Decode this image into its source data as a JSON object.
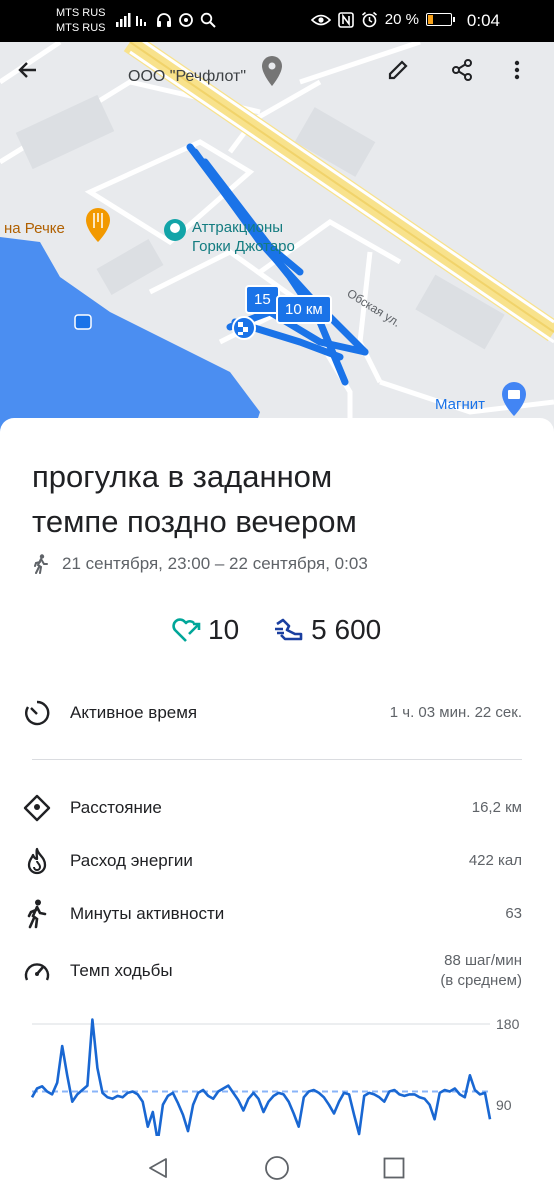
{
  "status_bar": {
    "carrier_1": "MTS RUS",
    "carrier_2": "MTS RUS",
    "battery": "20 %",
    "time": "0:04"
  },
  "map": {
    "place_title": "ООО \"Речфлот\"",
    "poi_restaurant": "на Речке",
    "poi_attraction_line1": "Аттракционы",
    "poi_attraction_line2": "Горки Джотаро",
    "street": "Обская ул.",
    "poi_store": "Магнит",
    "badge_15": "15",
    "badge_10": "10 км",
    "colors": {
      "route": "#1a73e8",
      "water": "#4b8ef1",
      "road_major": "#f8e28c"
    }
  },
  "toolbar": {
    "back_icon": "arrow-back-icon",
    "edit_icon": "pencil-icon",
    "share_icon": "share-icon",
    "more_icon": "more-vert-icon"
  },
  "activity": {
    "title_line1": "прогулка в заданном",
    "title_line2": "темпе поздно вечером",
    "dates": "21 сентября, 23:00 – 22 сентября, 0:03",
    "heart_points": "10",
    "steps": "5 600",
    "colors": {
      "heart": "#00a699",
      "steps": "#1a3fa0"
    }
  },
  "metrics": [
    {
      "icon": "timer-icon",
      "label": "Активное время",
      "value": "1 ч. 03 мин. 22 сек."
    },
    {
      "icon": "location-diamond-icon",
      "label": "Расстояние",
      "value": "16,2 км"
    },
    {
      "icon": "flame-icon",
      "label": "Расход энергии",
      "value": "422 кал"
    },
    {
      "icon": "walk-icon",
      "label": "Минуты активности",
      "value": "63"
    },
    {
      "icon": "speedometer-icon",
      "label": "Темп ходьбы",
      "value_line1": "88 шаг/мин",
      "value_line2": "(в среднем)"
    }
  ],
  "chart_data": {
    "type": "line",
    "title": "",
    "xlabel": "",
    "ylabel": "",
    "ylim": [
      0,
      180
    ],
    "y_ticks": [
      "180",
      "90"
    ],
    "average": 88,
    "series": [
      {
        "values": [
          80,
          92,
          95,
          88,
          84,
          100,
          150,
          110,
          74,
          84,
          90,
          96,
          186,
          120,
          86,
          80,
          78,
          82,
          80,
          86,
          88,
          84,
          74,
          40,
          60,
          20,
          70,
          82,
          86,
          72,
          56,
          34,
          70,
          86,
          90,
          82,
          78,
          88,
          92,
          96,
          86,
          76,
          62,
          78,
          86,
          78,
          60,
          74,
          82,
          86,
          84,
          74,
          58,
          40,
          80,
          88,
          90,
          86,
          80,
          70,
          58,
          74,
          86,
          84,
          56,
          30,
          82,
          86,
          84,
          80,
          74,
          88,
          90,
          84,
          82,
          84,
          84,
          80,
          78,
          70,
          50,
          86,
          90,
          88,
          92,
          84,
          80,
          110,
          90,
          84,
          86,
          50
        ]
      }
    ]
  },
  "nav": {
    "back": "nav-back-icon",
    "home": "nav-home-icon",
    "recents": "nav-recents-icon"
  }
}
